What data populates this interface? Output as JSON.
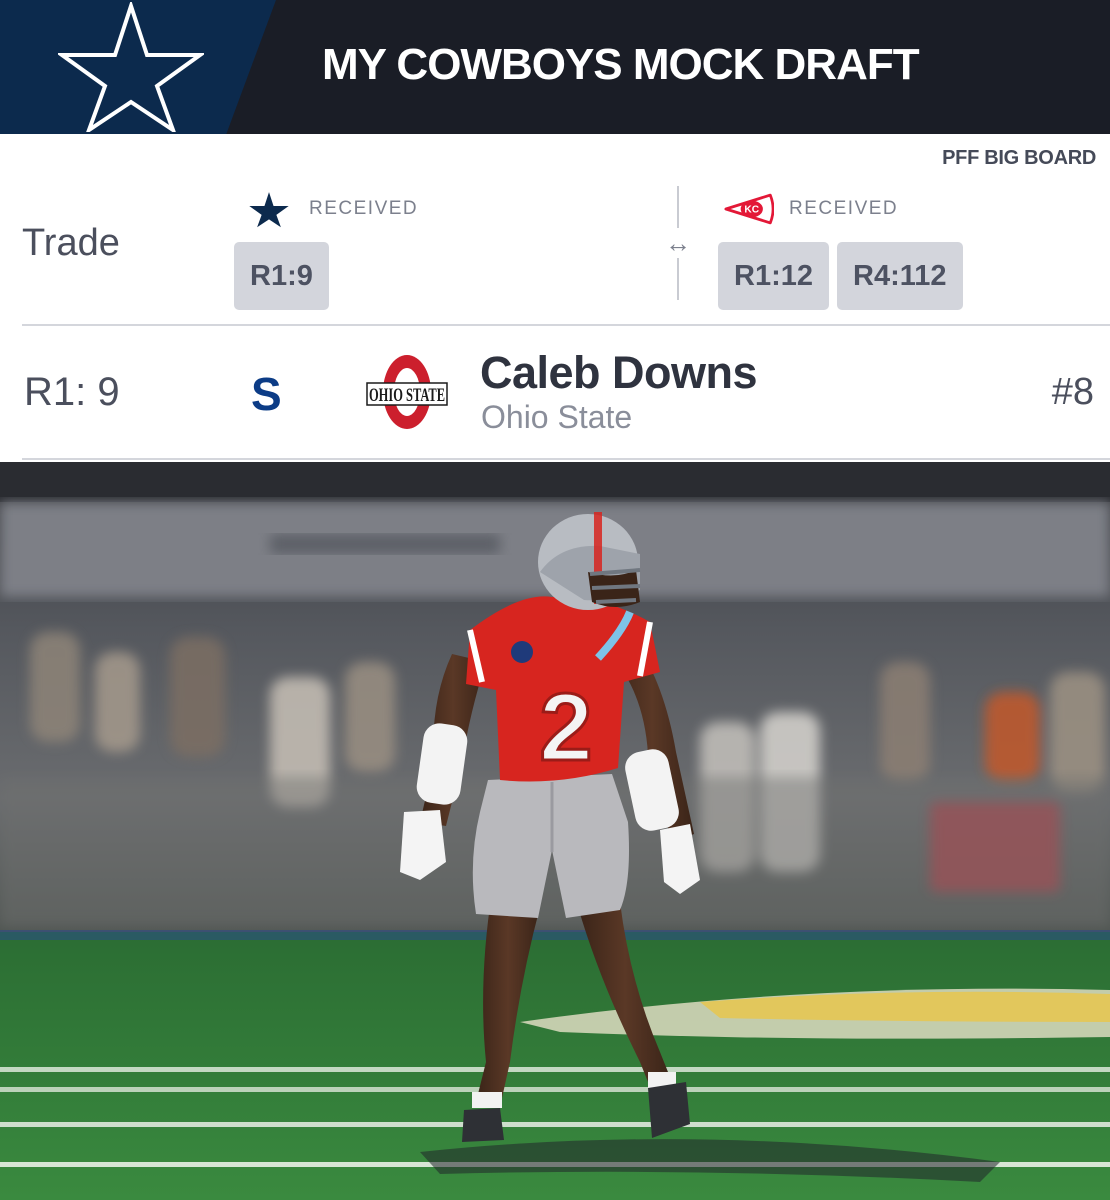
{
  "header": {
    "title": "MY COWBOYS MOCK DRAFT",
    "logo_icon": "cowboys-star-icon"
  },
  "trade": {
    "board_label": "PFF BIG BOARD",
    "label": "Trade",
    "swap_icon": "↔",
    "left": {
      "team_icon": "cowboys-star-icon",
      "received_label": "RECEIVED",
      "picks": [
        "R1:9"
      ]
    },
    "right": {
      "team_icon": "chiefs-arrowhead-icon",
      "received_label": "RECEIVED",
      "picks": [
        "R1:12",
        "R4:112"
      ]
    }
  },
  "pick": {
    "slot": "R1: 9",
    "position": "S",
    "player_name": "Caleb Downs",
    "school": "Ohio State",
    "school_logo_text": "OHIO STATE",
    "rank": "#8"
  },
  "photo": {
    "description_icon": "player-photo",
    "jersey_number": "2",
    "colors": {
      "jersey": "#d7251f",
      "pants": "#b9b9bd",
      "field": "#2f7a37"
    }
  },
  "colors": {
    "header_bg": "#1a1d26",
    "cowboys_navy": "#0c2a4d",
    "chip_bg": "#d3d5dc",
    "position_blue": "#0c3c86",
    "buckeye_red": "#cc1f2d",
    "chiefs_red": "#e31837"
  }
}
